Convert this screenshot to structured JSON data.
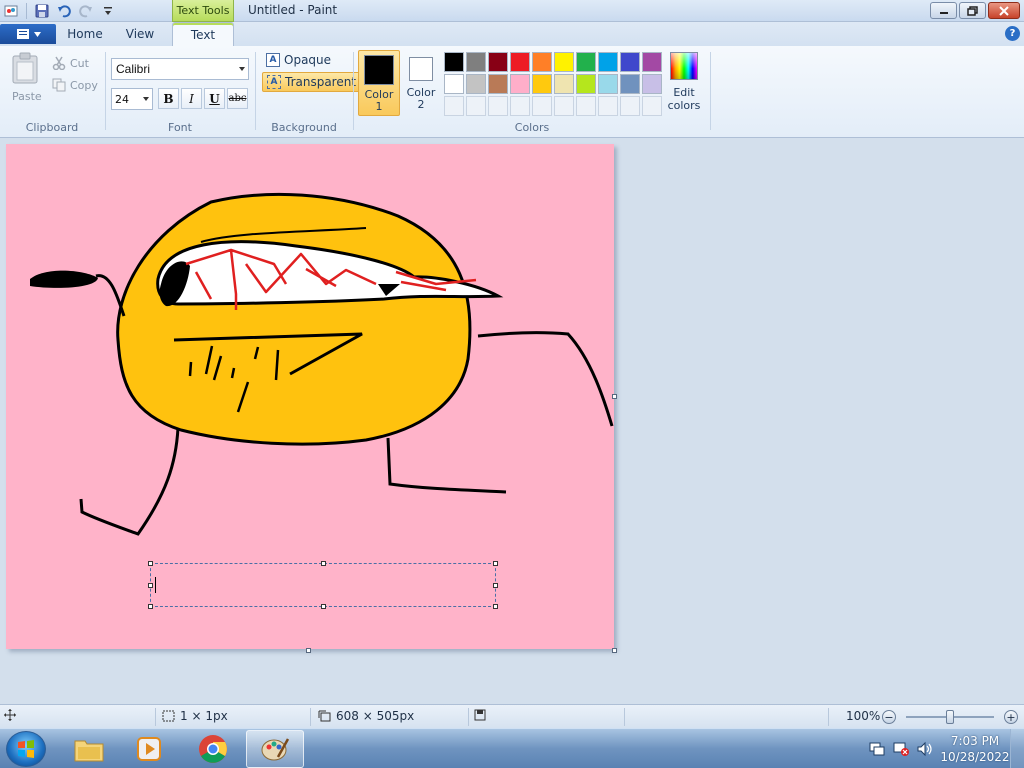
{
  "window": {
    "title": "Untitled - Paint",
    "context_tab": "Text Tools"
  },
  "tabs": [
    {
      "label": "Home"
    },
    {
      "label": "View"
    },
    {
      "label": "Text"
    }
  ],
  "clipboard": {
    "paste": "Paste",
    "cut": "Cut",
    "copy": "Copy",
    "group_label": "Clipboard"
  },
  "font": {
    "family": "Calibri",
    "size": "24",
    "bold": "B",
    "italic": "I",
    "underline": "U",
    "strike": "abc",
    "group_label": "Font"
  },
  "background": {
    "opaque": "Opaque",
    "transparent": "Transparent",
    "selected": "transparent",
    "group_label": "Background"
  },
  "colors": {
    "color1_label": "Color 1",
    "color1_line1": "Color",
    "color1_line2": "1",
    "color1": "#000000",
    "color2_line1": "Color",
    "color2_line2": "2",
    "color2": "#ffffff",
    "edit_line1": "Edit",
    "edit_line2": "colors",
    "group_label": "Colors",
    "palette_row1": [
      "#000000",
      "#7f7f7f",
      "#880015",
      "#ed1c24",
      "#ff7f27",
      "#fff200",
      "#22b14c",
      "#00a2e8",
      "#3f48cc",
      "#a349a4"
    ],
    "palette_row2": [
      "#ffffff",
      "#c3c3c3",
      "#b97a57",
      "#ffaec9",
      "#ffc90e",
      "#efe4b0",
      "#b5e61d",
      "#99d9ea",
      "#7092be",
      "#c8bfe7"
    ]
  },
  "canvas": {
    "background": "#ffb3c9"
  },
  "status": {
    "selection_size": "1 × 1px",
    "image_size": "608 × 505px",
    "zoom": "100%"
  },
  "taskbar": {
    "time": "7:03 PM",
    "date": "10/28/2022"
  }
}
